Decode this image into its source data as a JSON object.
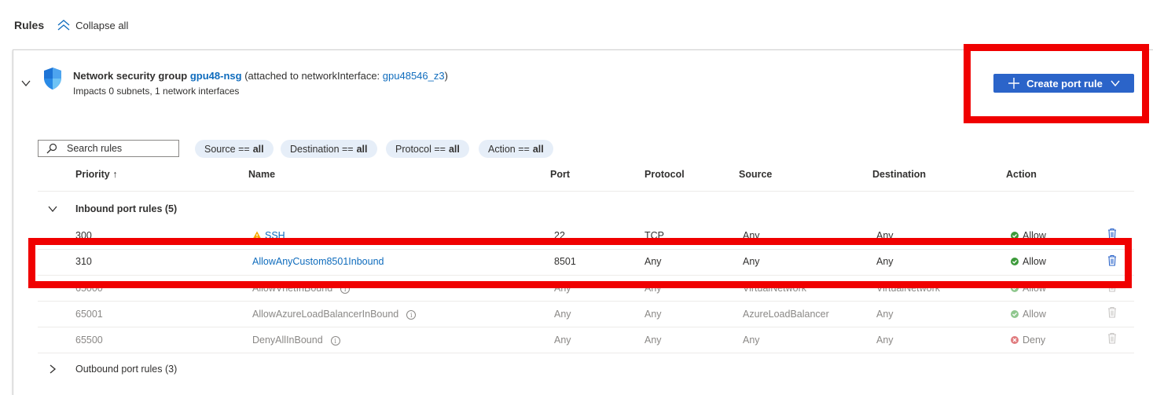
{
  "header": {
    "title": "Rules",
    "collapse_label": "Collapse all"
  },
  "nsg": {
    "prefix": "Network security group",
    "name": "gpu48-nsg",
    "attached_prefix": "(attached to networkInterface:",
    "nic": "gpu48546_z3",
    "attached_suffix": ")",
    "impacts": "Impacts 0 subnets, 1 network interfaces"
  },
  "create_button": {
    "label": "Create port rule"
  },
  "search": {
    "placeholder": "Search rules"
  },
  "filters": [
    {
      "label": "Source ==",
      "value": "all"
    },
    {
      "label": "Destination ==",
      "value": "all"
    },
    {
      "label": "Protocol ==",
      "value": "all"
    },
    {
      "label": "Action ==",
      "value": "all"
    }
  ],
  "columns": {
    "priority": "Priority ↑",
    "name": "Name",
    "port": "Port",
    "protocol": "Protocol",
    "source": "Source",
    "destination": "Destination",
    "action": "Action"
  },
  "inbound": {
    "label": "Inbound port rules (5)",
    "rows": [
      {
        "priority": "300",
        "name": "SSH",
        "port": "22",
        "protocol": "TCP",
        "source": "Any",
        "destination": "Any",
        "action": "Allow"
      },
      {
        "priority": "310",
        "name": "AllowAnyCustom8501Inbound",
        "port": "8501",
        "protocol": "Any",
        "source": "Any",
        "destination": "Any",
        "action": "Allow"
      },
      {
        "priority": "65000",
        "name": "AllowVnetInBound",
        "port": "Any",
        "protocol": "Any",
        "source": "VirtualNetwork",
        "destination": "VirtualNetwork",
        "action": "Allow"
      },
      {
        "priority": "65001",
        "name": "AllowAzureLoadBalancerInBound",
        "port": "Any",
        "protocol": "Any",
        "source": "AzureLoadBalancer",
        "destination": "Any",
        "action": "Allow"
      },
      {
        "priority": "65500",
        "name": "DenyAllInBound",
        "port": "Any",
        "protocol": "Any",
        "source": "Any",
        "destination": "Any",
        "action": "Deny"
      }
    ]
  },
  "outbound": {
    "label": "Outbound port rules (3)"
  },
  "colors": {
    "link": "#0f6cbd",
    "button": "#2b64c9",
    "allow": "#3c9a3a",
    "deny": "#d13438",
    "highlight": "#f00000"
  },
  "icons": [
    "chevrons-up-icon",
    "chevron-down-icon",
    "shield-icon",
    "plus-icon",
    "search-icon",
    "warning-icon",
    "info-icon",
    "check-circle-icon",
    "x-circle-icon",
    "trash-icon",
    "chevron-right-icon"
  ]
}
